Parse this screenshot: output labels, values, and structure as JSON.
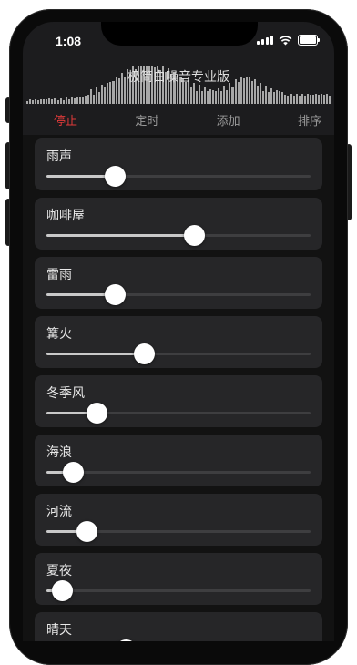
{
  "status_bar": {
    "time": "1:08"
  },
  "app": {
    "title": "极简白噪音专业版"
  },
  "menu": {
    "stop": "停止",
    "timer": "定时",
    "add": "添加",
    "sort": "排序"
  },
  "colors": {
    "accent": "#e03a3a",
    "background": "#1c1c1e",
    "card": "#262628"
  },
  "sounds": [
    {
      "label": "雨声",
      "volume": 0.26
    },
    {
      "label": "咖啡屋",
      "volume": 0.56
    },
    {
      "label": "雷雨",
      "volume": 0.26
    },
    {
      "label": "篝火",
      "volume": 0.37
    },
    {
      "label": "冬季风",
      "volume": 0.19
    },
    {
      "label": "海浪",
      "volume": 0.1
    },
    {
      "label": "河流",
      "volume": 0.15
    },
    {
      "label": "夏夜",
      "volume": 0.06
    },
    {
      "label": "晴天",
      "volume": 0.3
    }
  ]
}
